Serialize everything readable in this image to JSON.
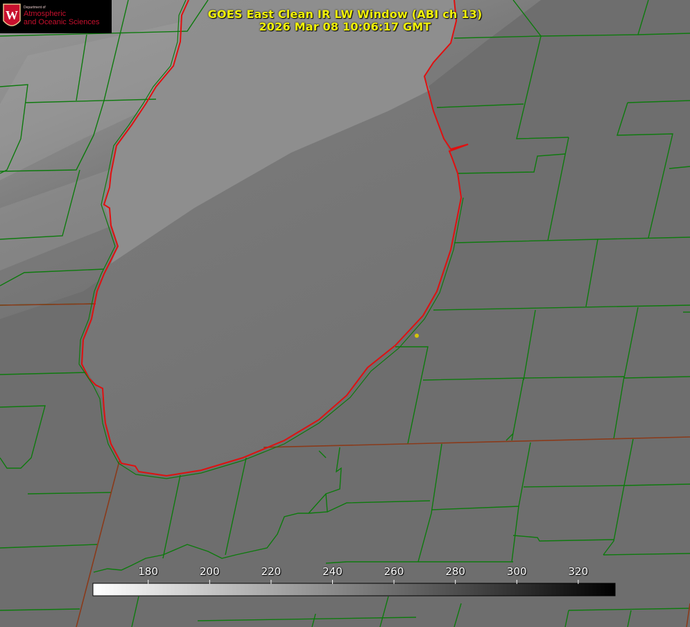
{
  "title": {
    "line1": "GOES East Clean IR LW Window (ABI ch 13)",
    "line2": "2026 Mar 08 10:06:17 GMT"
  },
  "logo": {
    "dept": "Department of",
    "line1": "Atmospheric",
    "line2": "and Oceanic Sciences",
    "letter": "W"
  },
  "colorbar": {
    "ticks": [
      "180",
      "200",
      "220",
      "240",
      "260",
      "280",
      "300",
      "320"
    ],
    "range": [
      162,
      332
    ],
    "gradient": [
      "#ffffff",
      "#000000"
    ]
  },
  "colors": {
    "boundary": "#0d7a0d",
    "coastline": "#e01010",
    "title": "#f2f20a",
    "marker": "#d4c40a"
  },
  "icons": {
    "logo": "university-crest-icon",
    "marker": "station-dot-icon"
  }
}
